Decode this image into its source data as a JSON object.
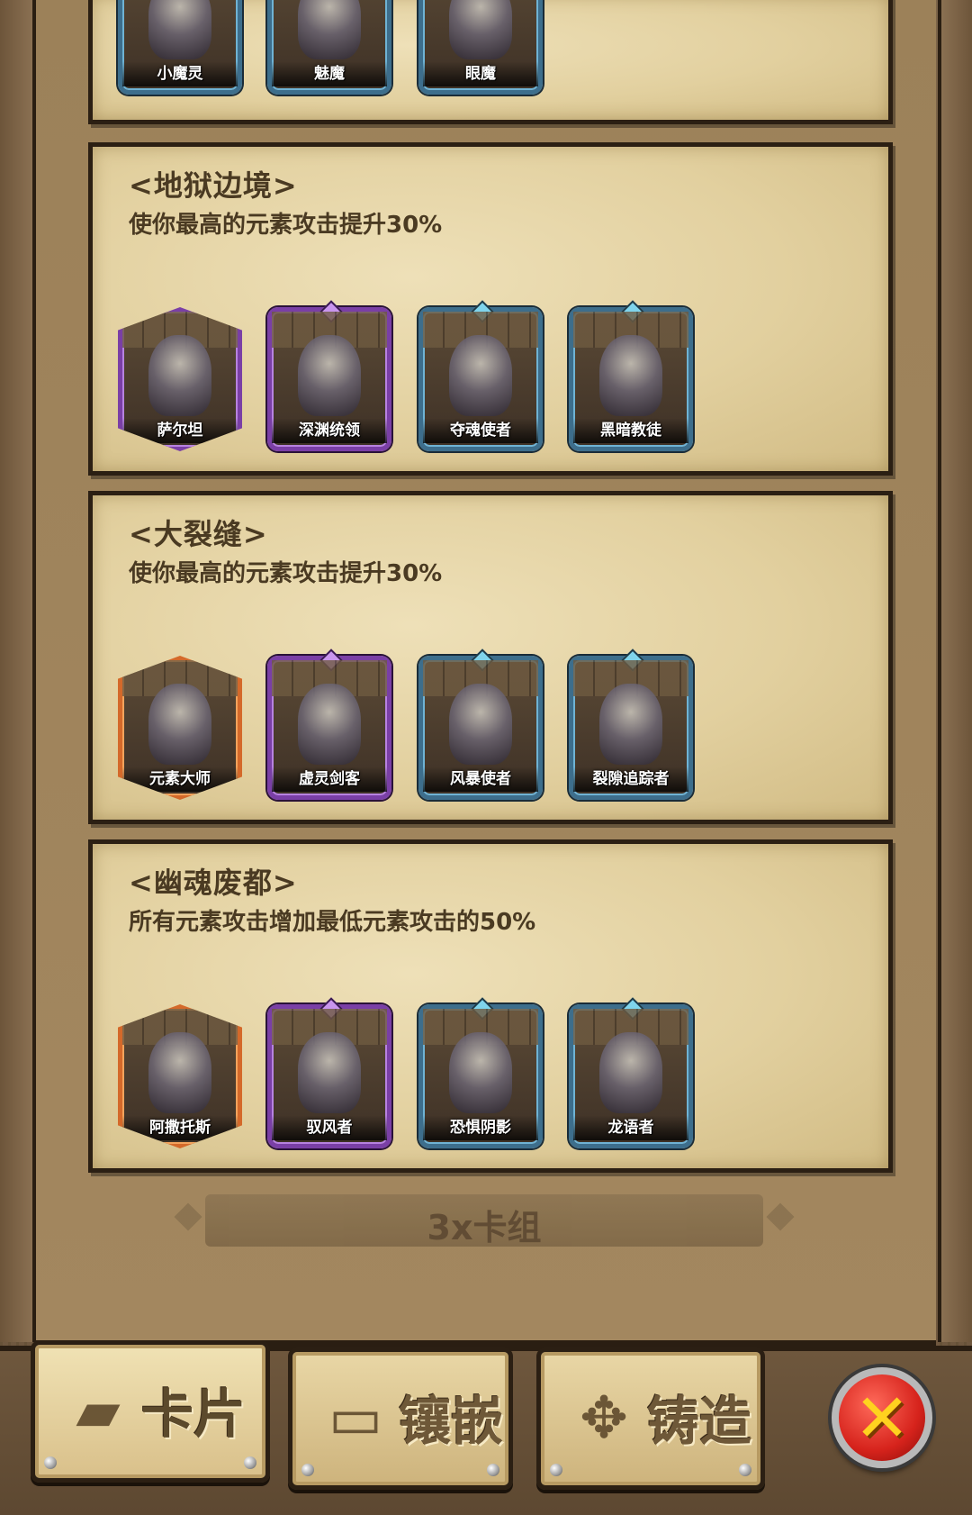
{
  "top_panel": {
    "cards": [
      {
        "name": "小魔灵",
        "frame": "blue"
      },
      {
        "name": "魅魔",
        "frame": "blue"
      },
      {
        "name": "眼魔",
        "frame": "blue"
      }
    ]
  },
  "sets": [
    {
      "title": "<地狱边境>",
      "desc": "使你最高的元素攻击提升30%",
      "cards": [
        {
          "name": "萨尔坦",
          "frame": "purple",
          "shape": "hex"
        },
        {
          "name": "深渊统领",
          "frame": "purple"
        },
        {
          "name": "夺魂使者",
          "frame": "blue"
        },
        {
          "name": "黑暗教徒",
          "frame": "blue"
        }
      ]
    },
    {
      "title": "<大裂缝>",
      "desc": "使你最高的元素攻击提升30%",
      "cards": [
        {
          "name": "元素大师",
          "frame": "orange",
          "shape": "hex"
        },
        {
          "name": "虚灵剑客",
          "frame": "purple"
        },
        {
          "name": "风暴使者",
          "frame": "blue"
        },
        {
          "name": "裂隙追踪者",
          "frame": "blue"
        }
      ]
    },
    {
      "title": "<幽魂废都>",
      "desc": "所有元素攻击增加最低元素攻击的50%",
      "cards": [
        {
          "name": "阿撒托斯",
          "frame": "orange",
          "shape": "hex"
        },
        {
          "name": "驭风者",
          "frame": "purple"
        },
        {
          "name": "恐惧阴影",
          "frame": "blue"
        },
        {
          "name": "龙语者",
          "frame": "blue"
        }
      ]
    }
  ],
  "deck_label": "3x卡组",
  "tabs": [
    {
      "label": "卡片",
      "icon": "cards-icon",
      "active": true
    },
    {
      "label": "镶嵌",
      "icon": "book-icon",
      "active": false
    },
    {
      "label": "铸造",
      "icon": "forge-icon",
      "active": false
    }
  ],
  "close_icon": "close-icon",
  "colors": {
    "parchment": "#e2d09f",
    "frame_blue": "#3d6e8c",
    "frame_purple": "#7a3fa6",
    "frame_orange": "#d4692a",
    "close_red": "#d6231c",
    "close_x": "#ffd21f"
  }
}
